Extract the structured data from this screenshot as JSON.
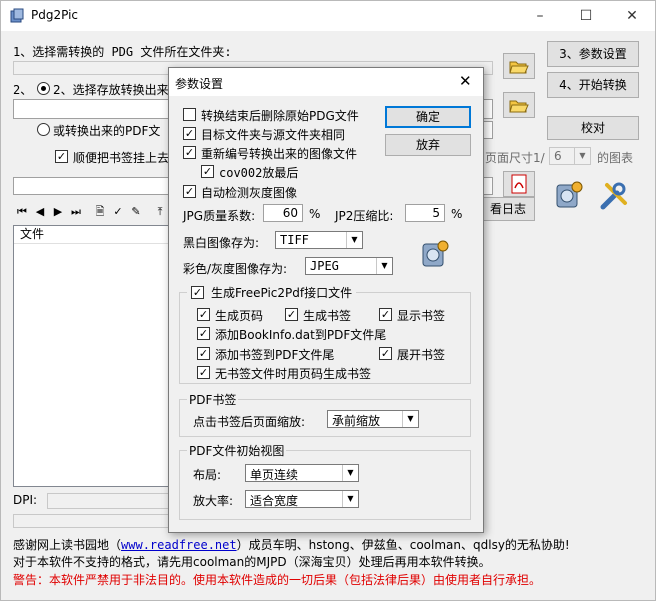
{
  "window": {
    "title": "Pdg2Pic"
  },
  "main": {
    "step1_label": "1、选择需转换的 PDG 文件所在文件夹:",
    "step2_label": "2、选择存放转换出来的",
    "or_label": "或转换出来的PDF文",
    "bookmark_label": "顺便把书签挂上去",
    "btn_settings": "3、参数设置",
    "btn_start": "4、开始转换",
    "btn_proofread": "校对",
    "pagesize_label": "页面尺寸1/",
    "pagesize_value": "6",
    "pagesize_suffix": "的图表",
    "btn_log": "看日志",
    "file_column": "文件",
    "dpi_label": "DPI:",
    "thanks_prefix": "感谢网上读书园地（",
    "thanks_link": "www.readfree.net",
    "thanks_suffix": "）成员车明、hstong、伊兹鱼、coolman、qdlsy的无私协助!",
    "note": "对于本软件不支持的格式，请先用coolman的MJPD（深海宝贝）处理后再用本软件转换。",
    "warning": "警告：本软件严禁用于非法目的。使用本软件造成的一切后果（包括法律后果）由使用者自行承担。"
  },
  "dialog": {
    "title": "参数设置",
    "ok": "确定",
    "cancel": "放弃",
    "opt_delete_pdg": "转换结束后删除原始PDG文件",
    "opt_same_folder": "目标文件夹与源文件夹相同",
    "opt_renumber": "重新编号转换出来的图像文件",
    "opt_cov002": "cov002放最后",
    "opt_auto_gray": "自动检测灰度图像",
    "jpg_quality_label": "JPG质量系数:",
    "jpg_quality_value": "60",
    "jpg_quality_unit": "%",
    "jp2_label": "JP2压缩比:",
    "jp2_value": "5",
    "jp2_unit": "%",
    "bw_label": "黑白图像存为:",
    "bw_value": "TIFF",
    "color_label": "彩色/灰度图像存为:",
    "color_value": "JPEG",
    "gen_free_label": "生成FreePic2Pdf接口文件",
    "gen_pagenum": "生成页码",
    "gen_bookmark": "生成书签",
    "show_bookmark": "显示书签",
    "add_bookinfo": "添加BookInfo.dat到PDF文件尾",
    "add_bookmark_tail": "添加书签到PDF文件尾",
    "expand_bookmark": "展开书签",
    "no_bookmark_gen": "无书签文件时用页码生成书签",
    "pdf_bookmark_group": "PDF书签",
    "zoom_after_click_label": "点击书签后页面缩放:",
    "zoom_after_click_value": "承前缩放",
    "pdf_view_group": "PDF文件初始视图",
    "layout_label": "布局:",
    "layout_value": "单页连续",
    "zoom_label": "放大率:",
    "zoom_value": "适合宽度"
  },
  "checks": {
    "delete_pdg": false,
    "same_folder": true,
    "renumber": true,
    "cov002": true,
    "auto_gray": true,
    "gen_free": true,
    "gen_pagenum": true,
    "gen_bookmark": true,
    "show_bookmark": true,
    "add_bookinfo": true,
    "add_bookmark_tail": true,
    "expand_bookmark": true,
    "no_bookmark_gen": true,
    "main_bookmark": true
  }
}
